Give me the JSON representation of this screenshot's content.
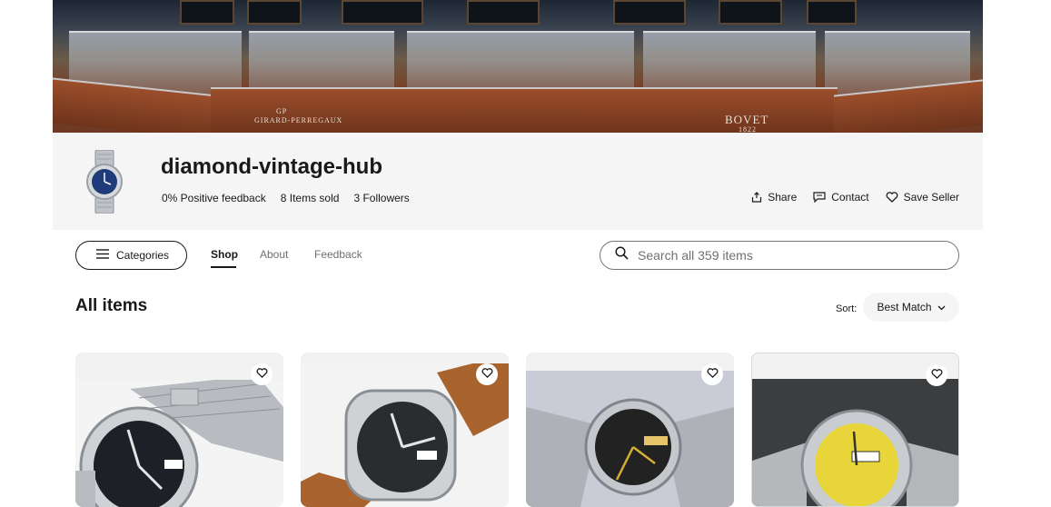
{
  "banner": {
    "brand_left": "GIRARD-PERREGAUX",
    "brand_left_mark": "GP",
    "brand_right": "BOVET",
    "brand_right_year": "1822"
  },
  "store": {
    "name": "diamond-vintage-hub",
    "positive_feedback": "0% Positive feedback",
    "items_sold": "8 Items sold",
    "followers": "3 Followers"
  },
  "actions": {
    "share": "Share",
    "contact": "Contact",
    "save_seller": "Save Seller"
  },
  "nav": {
    "categories": "Categories",
    "tabs": [
      {
        "label": "Shop",
        "active": true
      },
      {
        "label": "About",
        "active": false
      },
      {
        "label": "Feedback",
        "active": false
      }
    ]
  },
  "search": {
    "placeholder": "Search all 359 items"
  },
  "listing": {
    "title": "All items",
    "sort_label": "Sort:",
    "sort_value": "Best Match"
  },
  "items": [
    {
      "icon": "watch-black-dial-mesh-icon",
      "dial": "#1d2127",
      "strap": "mesh"
    },
    {
      "icon": "watch-black-dial-leather-icon",
      "dial": "#2a2d30",
      "strap": "leather"
    },
    {
      "icon": "watch-black-gold-dial-mesh-icon",
      "dial": "#222222",
      "strap": "mesh"
    },
    {
      "icon": "watch-yellow-dial-mesh-icon",
      "dial": "#e8d53a",
      "strap": "mesh"
    }
  ],
  "colors": {
    "text_primary": "#191919",
    "text_secondary": "#707070",
    "header_bg": "#f5f5f5"
  }
}
